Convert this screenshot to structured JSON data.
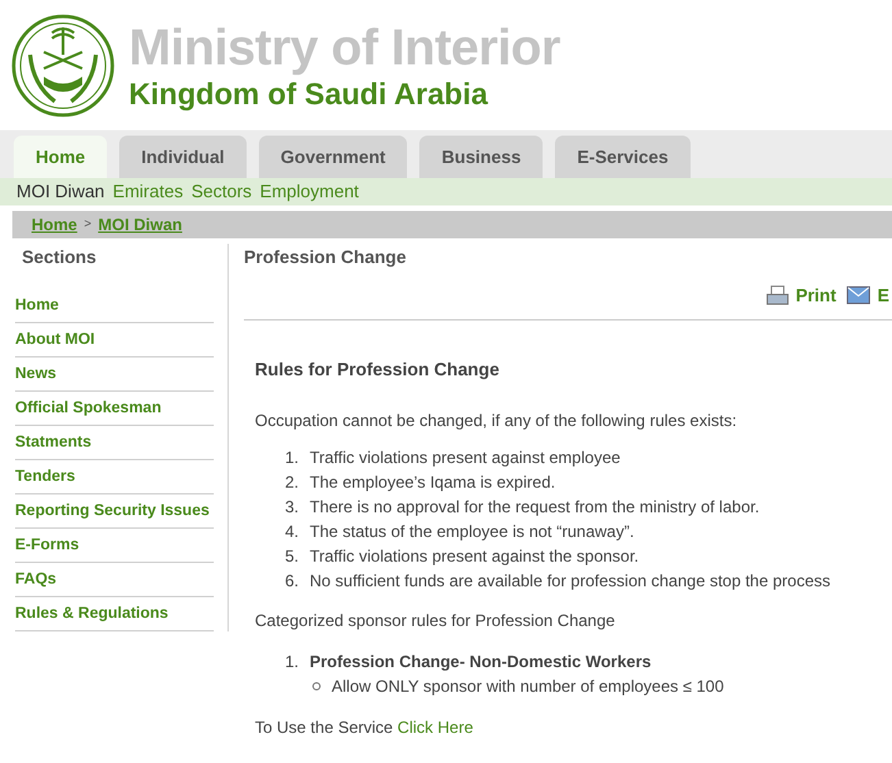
{
  "header": {
    "title": "Ministry of Interior",
    "subtitle": "Kingdom of Saudi Arabia"
  },
  "tabs": [
    {
      "label": "Home",
      "selected": true
    },
    {
      "label": "Individual",
      "selected": false
    },
    {
      "label": "Government",
      "selected": false
    },
    {
      "label": "Business",
      "selected": false
    },
    {
      "label": "E-Services",
      "selected": false
    }
  ],
  "submenu": [
    {
      "label": "MOI Diwan",
      "selected": true
    },
    {
      "label": "Emirates",
      "selected": false
    },
    {
      "label": "Sectors",
      "selected": false
    },
    {
      "label": "Employment",
      "selected": false
    }
  ],
  "breadcrumb": {
    "items": [
      "Home",
      "MOI Diwan"
    ],
    "separator": ">"
  },
  "sidebar": {
    "title": "Sections",
    "items": [
      "Home",
      "About MOI",
      "News",
      "Official Spokesman",
      "Statments",
      "Tenders",
      "Reporting Security Issues",
      "E-Forms",
      "FAQs",
      "Rules & Regulations"
    ]
  },
  "content": {
    "title": "Profession Change",
    "actions": [
      {
        "kind": "print",
        "label": "Print"
      },
      {
        "kind": "email",
        "label": "E"
      }
    ],
    "heading": "Rules for Profession Change",
    "intro": "Occupation cannot be changed, if any of the following rules exists:",
    "rules": [
      {
        "number": "1.",
        "text": "Traffic violations present against employee"
      },
      {
        "number": "2.",
        "text": "The employee’s Iqama is expired."
      },
      {
        "number": "3.",
        "text": "There is no approval for the request from the ministry of labor."
      },
      {
        "number": "4.",
        "text": "The status of the employee is not “runaway”."
      },
      {
        "number": "5.",
        "text": "Traffic violations present against the sponsor."
      },
      {
        "number": "6.",
        "text": "No sufficient funds are available for profession change stop the process"
      }
    ],
    "categories_intro": "Categorized sponsor rules for Profession Change",
    "categories": [
      {
        "number": "1.",
        "title": "Profession Change- Non-Domestic Workers",
        "rules": [
          "Allow ONLY sponsor with number of employees ≤ 100"
        ]
      }
    ],
    "service_text": "To Use the Service",
    "service_link": "Click Here"
  }
}
